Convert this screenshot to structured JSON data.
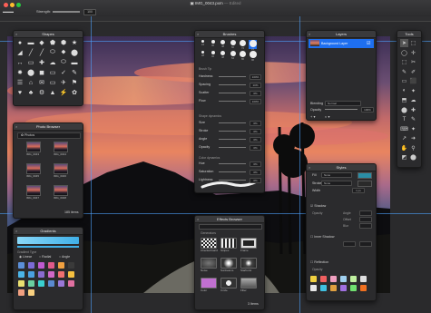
{
  "window": {
    "title": "IMG_0043.pxm",
    "title_sep": "—",
    "edited": "Edited",
    "toolbar": {
      "strength_label": "Strength:",
      "strength_value": "100"
    }
  },
  "colors": {
    "accent": "#1e6ff0",
    "guide": "#4ea3ff"
  },
  "shapes_panel": {
    "title": "Shapes",
    "icons": [
      "●",
      "▬",
      "◆",
      "⬟",
      "⬢",
      "★",
      "◢",
      "╱",
      "╱",
      "⬭",
      "⬥",
      "⬤",
      "↔",
      "▭",
      "✚",
      "☁",
      "⬭",
      "▬",
      "✸",
      "⬤",
      "◼",
      "▭",
      "✓",
      "✎",
      "☰",
      "⌂",
      "✉",
      "▭",
      "✈",
      "⚑",
      "♥",
      "♣",
      "⚙",
      "▲",
      "⚡",
      "✿"
    ]
  },
  "photo_browser": {
    "title": "Photo Browser",
    "source": "Photos",
    "thumbs": [
      "IMG_0043",
      "IMG_0044",
      "IMG_0045",
      "IMG_0046",
      "IMG_0047",
      "IMG_0048"
    ],
    "count": "185 items"
  },
  "gradients": {
    "title": "Gradients",
    "gradient_type_label": "Gradient Type",
    "types": [
      "Linear",
      "Radial",
      "Angle"
    ],
    "swatch_colors": [
      "#5b8fd8",
      "#7c6bd6",
      "#c05ad0",
      "#e05a8a",
      "#f0a040",
      "#3a3a3a",
      "#4bb5e8",
      "#4aa0e0",
      "#8a6cd0",
      "#d068c8",
      "#f07070",
      "#f5c040",
      "#eae070",
      "#6ad0a0",
      "#3ad0d0",
      "#5a8ad0",
      "#9a78d8",
      "#e070a0",
      "#f0a080",
      "#f8d080"
    ]
  },
  "brushes": {
    "title": "Brushes",
    "sizes": [
      "24",
      "36",
      "48",
      "60",
      "72",
      "24",
      "28",
      "32",
      "48",
      "64",
      "80",
      "96"
    ],
    "brush_tip_label": "Brush Tip",
    "rows": [
      {
        "label": "Hardness",
        "value": "100%"
      },
      {
        "label": "Spacing",
        "value": "10%"
      },
      {
        "label": "Scatter",
        "value": "0%"
      },
      {
        "label": "Flow",
        "value": "100%"
      }
    ],
    "shape_dynamics_label": "Shape dynamics",
    "dyn_rows": [
      {
        "label": "Size",
        "value": "0%"
      },
      {
        "label": "Stroke",
        "value": "0%"
      },
      {
        "label": "Angle",
        "value": "0%"
      },
      {
        "label": "Opacity",
        "value": "0%"
      }
    ],
    "color_dynamics_label": "Color dynamics",
    "color_rows": [
      {
        "label": "Hue",
        "value": "0%"
      },
      {
        "label": "Saturation",
        "value": "0%"
      },
      {
        "label": "Lightness",
        "value": "0%"
      }
    ]
  },
  "layers": {
    "title": "Layers",
    "layer_name": "Background Layer",
    "blending_label": "Blending",
    "blending_value": "Normal",
    "opacity_label": "Opacity",
    "opacity_value": "100%"
  },
  "styles": {
    "title": "Styles",
    "fill_label": "Fill",
    "fill_value": "None",
    "stroke_label": "Stroke",
    "stroke_value": "None",
    "width_label": "Width",
    "width_value": "1 px",
    "shadow_label": "Shadow",
    "inner_shadow_label": "Inner Shadow",
    "reflection_label": "Reflection",
    "opacity_label": "Opacity",
    "angle_label": "Angle",
    "offset_label": "Offset",
    "blur_label": "Blur",
    "size_label": "Size",
    "swatch_colors": [
      "#f0d040",
      "#f06060",
      "#f0a0c0",
      "#a0d0f0",
      "#c0f0a0",
      "#e0e0e0",
      "#e8e8e8",
      "#40c0e0",
      "#e0a040",
      "#a070e0",
      "#70e070",
      "#f07020"
    ]
  },
  "effects": {
    "title": "Effects Browser",
    "category": "Generators",
    "labels": [
      "Checkerboard",
      "Stripes",
      "Frame",
      "Noise",
      "Sunbeams",
      "Starburst",
      "Color",
      "Circle",
      "Filter"
    ],
    "status": "3 Items"
  },
  "tools": {
    "title": "Tools",
    "icons": [
      "➤",
      "⬚",
      "◯",
      "✛",
      "⬚",
      "✂",
      "✎",
      "✐",
      "▭",
      "⬛",
      "◐",
      "✦",
      "⬒",
      "☁",
      "⬤",
      "✚",
      "T",
      "✎",
      "⌨",
      "✦",
      "↗",
      "➜",
      "✋",
      "⚲",
      "◩",
      "⬤"
    ]
  }
}
